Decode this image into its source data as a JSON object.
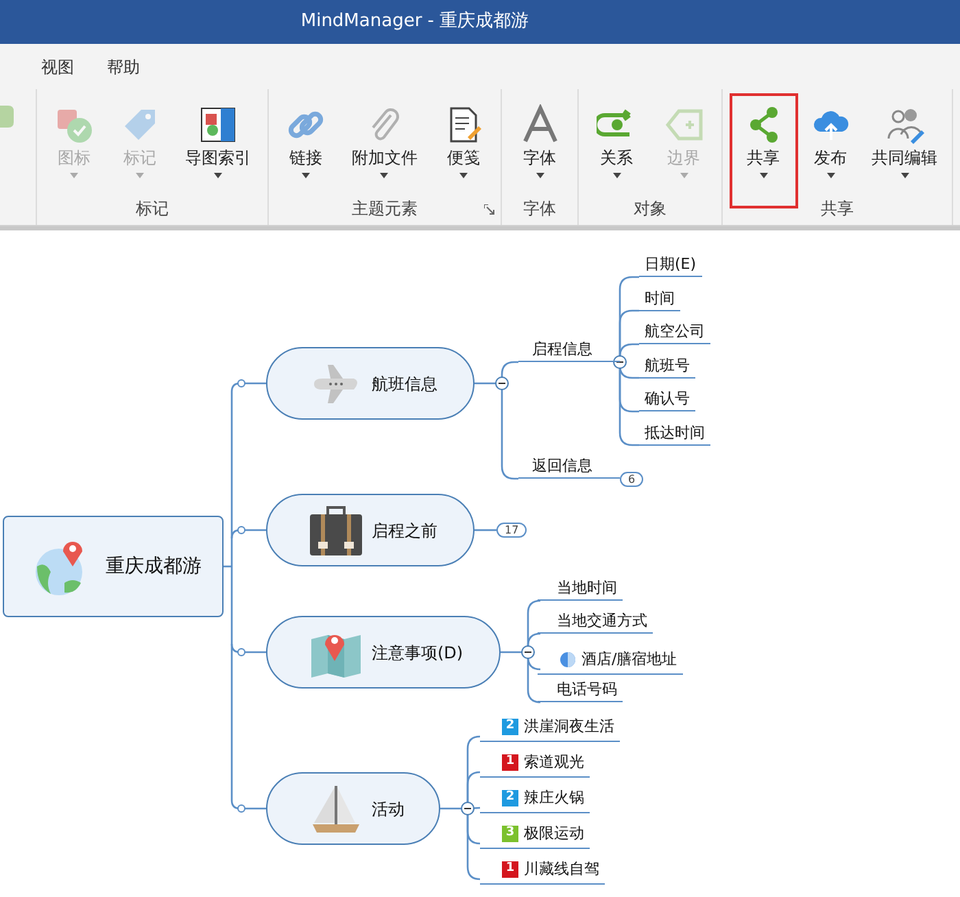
{
  "window": {
    "title": "MindManager - 重庆成都游"
  },
  "menu": [
    {
      "label": "视图"
    },
    {
      "label": "帮助"
    }
  ],
  "ribbon": {
    "groups": [
      {
        "label": "标记",
        "launcher": false,
        "items": [
          {
            "label": "图标",
            "disabled": true,
            "dropdown": true,
            "highlighted": false
          },
          {
            "label": "标记",
            "disabled": true,
            "dropdown": true,
            "highlighted": false
          },
          {
            "label": "导图索引",
            "disabled": false,
            "dropdown": true,
            "highlighted": false
          }
        ]
      },
      {
        "label": "主题元素",
        "launcher": true,
        "items": [
          {
            "label": "链接",
            "disabled": false,
            "dropdown": true,
            "highlighted": false
          },
          {
            "label": "附加文件",
            "disabled": false,
            "dropdown": true,
            "highlighted": false
          },
          {
            "label": "便笺",
            "disabled": false,
            "dropdown": true,
            "highlighted": false
          }
        ]
      },
      {
        "label": "字体",
        "launcher": false,
        "items": [
          {
            "label": "字体",
            "disabled": false,
            "dropdown": true,
            "highlighted": false
          }
        ]
      },
      {
        "label": "对象",
        "launcher": false,
        "items": [
          {
            "label": "关系",
            "disabled": false,
            "dropdown": true,
            "highlighted": false
          },
          {
            "label": "边界",
            "disabled": true,
            "dropdown": true,
            "highlighted": false
          }
        ]
      },
      {
        "label": "共享",
        "launcher": false,
        "items": [
          {
            "label": "共享",
            "disabled": false,
            "dropdown": true,
            "highlighted": true
          },
          {
            "label": "发布",
            "disabled": false,
            "dropdown": true,
            "highlighted": false
          },
          {
            "label": "共同编辑",
            "disabled": false,
            "dropdown": true,
            "highlighted": false
          }
        ]
      }
    ]
  },
  "map": {
    "central": {
      "title": "重庆成都游"
    },
    "topics": [
      {
        "title": "航班信息",
        "expanded": true,
        "children": [
          {
            "title": "启程信息",
            "expanded": true,
            "children": [
              {
                "title": "日期(E)"
              },
              {
                "title": "时间"
              },
              {
                "title": "航空公司"
              },
              {
                "title": "航班号"
              },
              {
                "title": "确认号"
              },
              {
                "title": "抵达时间"
              }
            ]
          },
          {
            "title": "返回信息",
            "expanded": false,
            "count": "6"
          }
        ]
      },
      {
        "title": "启程之前",
        "expanded": false,
        "count": "17"
      },
      {
        "title": "注意事项(D)",
        "expanded": true,
        "children": [
          {
            "title": "当地时间",
            "kind": "plain"
          },
          {
            "title": "当地交通方式",
            "kind": "plain"
          },
          {
            "title": "酒店/膳宿地址",
            "kind": "note"
          },
          {
            "title": "电话号码",
            "kind": "plain"
          }
        ]
      },
      {
        "title": "活动",
        "expanded": true,
        "children": [
          {
            "title": "洪崖洞夜生活",
            "badge": "2",
            "color": "#1e9ae0"
          },
          {
            "title": "索道观光",
            "badge": "1",
            "color": "#d4161e"
          },
          {
            "title": "辣庄火锅",
            "badge": "2",
            "color": "#1e9ae0"
          },
          {
            "title": "极限运动",
            "badge": "3",
            "color": "#7cc12e"
          },
          {
            "title": "川藏线自驾",
            "badge": "1",
            "color": "#d4161e"
          }
        ]
      }
    ]
  }
}
